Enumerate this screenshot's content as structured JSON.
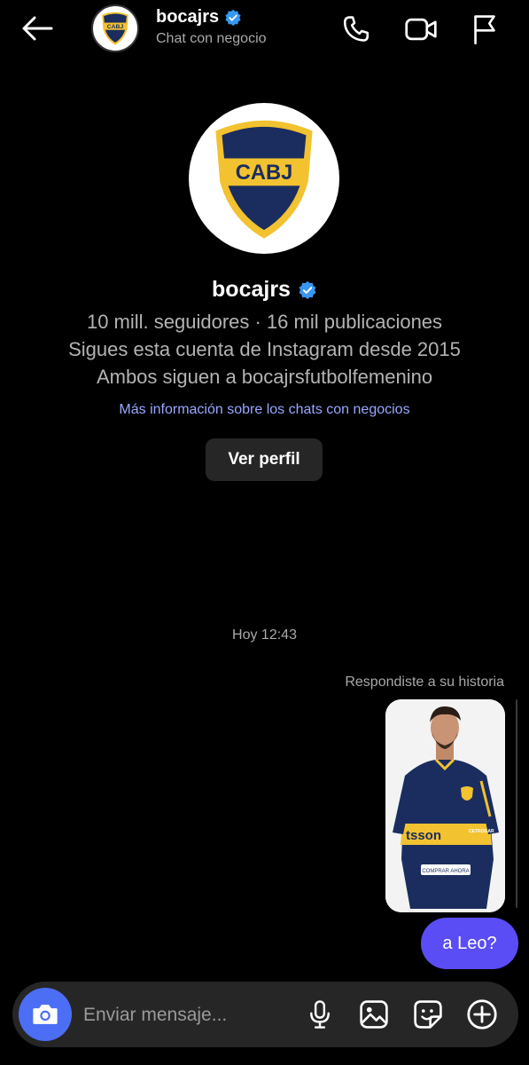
{
  "header": {
    "name": "bocajrs",
    "subtitle": "Chat con negocio",
    "avatar_text": "CABJ"
  },
  "profile": {
    "avatar_text": "CABJ",
    "name": "bocajrs",
    "stats": "10 mill. seguidores · 16 mil publicaciones",
    "following_since": "Sigues esta cuenta de Instagram desde 2015",
    "mutual": "Ambos siguen a bocajrsfutbolfemenino",
    "info_link": "Más información sobre los chats con negocios",
    "view_profile_button": "Ver perfil"
  },
  "conversation": {
    "timestamp": "Hoy 12:43",
    "reply_label": "Respondiste a su historia",
    "story": {
      "shirt_sponsor": "tsson",
      "sleeve_text": "CETROGAR",
      "cta": "COMPRAR AHORA"
    },
    "message": "a Leo?"
  },
  "composer": {
    "placeholder": "Enviar mensaje..."
  },
  "colors": {
    "background": "#000000",
    "link": "#9aa7ff",
    "bubble": "#5b4df5",
    "camera_button": "#4c6ef5",
    "verified": "#3897f0",
    "boca_blue": "#1a2d5e",
    "boca_gold": "#f2c230"
  },
  "icons": {
    "back": "arrow-left-icon",
    "call": "phone-icon",
    "video": "video-camera-icon",
    "report": "flag-icon",
    "verified": "verified-badge-icon",
    "camera": "camera-icon",
    "mic": "microphone-icon",
    "gallery": "image-icon",
    "sticker": "sticker-icon",
    "plus": "plus-circle-icon"
  }
}
